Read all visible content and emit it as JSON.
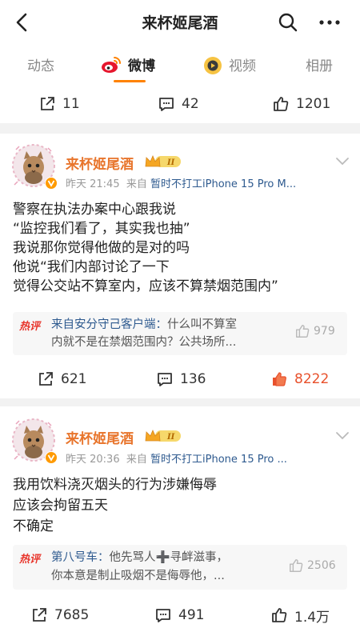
{
  "header": {
    "title": "来杯姬尾酒"
  },
  "tabs": [
    {
      "label": "动态"
    },
    {
      "label": "微博"
    },
    {
      "label": "视频"
    },
    {
      "label": "相册"
    }
  ],
  "prev_actions": {
    "repost": "11",
    "comment": "42",
    "like": "1201"
  },
  "posts": [
    {
      "username": "来杯姬尾酒",
      "time": "昨天 21:45",
      "source_prefix": "来自",
      "device": "暂时不打工iPhone 15 Pro M...",
      "lines": [
        "警察在执法办案中心跟我说",
        "“监控我们看了，其实我也抽”",
        "我说那你觉得他做的是对的吗",
        "他说“我们内部讨论了一下",
        "觉得公交站不算室内，应该不算禁烟范围内”"
      ],
      "hot_tag": "热评",
      "hot_author": "来自安分守己客户端：",
      "hot_line1": "什么叫不算室",
      "hot_line2": "内就不是在禁烟范围内？公共场所...",
      "hot_likes": "979",
      "repost": "621",
      "comment": "136",
      "like": "8222"
    },
    {
      "username": "来杯姬尾酒",
      "time": "昨天 20:36",
      "source_prefix": "来自",
      "device": "暂时不打工iPhone 15 Pro ...",
      "lines": [
        "我用饮料浇灭烟头的行为涉嫌侮辱",
        "应该会拘留五天",
        "不确定"
      ],
      "hot_tag": "热评",
      "hot_author": "第八号车：",
      "hot_line1": "他先骂人➕寻衅滋事，",
      "hot_line2": "你本意是制止吸烟不是侮辱他，...",
      "hot_likes": "2506",
      "repost": "7685",
      "comment": "491",
      "like": "1.4万"
    }
  ],
  "colors": {
    "accent": "#ff8200",
    "username": "#e8752c",
    "link": "#2e5a8f",
    "hot": "#e8362c"
  }
}
